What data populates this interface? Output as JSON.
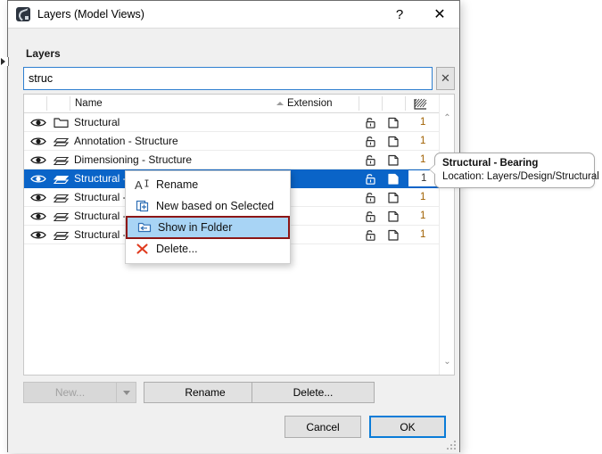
{
  "window": {
    "title": "Layers (Model Views)",
    "app_icon": "archicad-logo-icon",
    "help_label": "?",
    "close_label": "✕"
  },
  "section": {
    "label": "Layers"
  },
  "search": {
    "value": "struc",
    "placeholder": "",
    "clear_label": "✕"
  },
  "list": {
    "columns": [
      {
        "key": "visibility",
        "label": ""
      },
      {
        "key": "type",
        "label": ""
      },
      {
        "key": "name",
        "label": "Name",
        "sorted": "asc"
      },
      {
        "key": "extension",
        "label": "Extension"
      },
      {
        "key": "lock",
        "label": ""
      },
      {
        "key": "copy",
        "label": ""
      },
      {
        "key": "intersection",
        "label": "intersection-priority-icon"
      }
    ],
    "rows": [
      {
        "name": "Structural",
        "type": "folder",
        "extension": "",
        "lock": "unlocked",
        "copy": "copy",
        "number": "1",
        "selected": false
      },
      {
        "name": "Annotation - Structure",
        "type": "layer",
        "extension": "",
        "lock": "unlocked",
        "copy": "copy",
        "number": "1",
        "selected": false
      },
      {
        "name": "Dimensioning - Structure",
        "type": "layer",
        "extension": "",
        "lock": "unlocked",
        "copy": "copy",
        "number": "1",
        "selected": false
      },
      {
        "name": "Structural - ",
        "type": "layer",
        "extension": "",
        "lock": "unlocked",
        "copy": "copy",
        "number": "1",
        "selected": true
      },
      {
        "name": "Structural - ",
        "type": "layer",
        "extension": "",
        "lock": "unlocked",
        "copy": "copy",
        "number": "1",
        "selected": false
      },
      {
        "name": "Structural - ",
        "type": "layer",
        "extension": "",
        "lock": "unlocked",
        "copy": "copy",
        "number": "1",
        "selected": false
      },
      {
        "name": "Structural - ",
        "type": "layer",
        "extension": "",
        "lock": "unlocked",
        "copy": "copy",
        "number": "1",
        "selected": false
      }
    ],
    "scroll_up": "⌃",
    "scroll_down": "⌄"
  },
  "context_menu": {
    "items": [
      {
        "label": "Rename",
        "icon": "rename-text-icon",
        "highlighted": false
      },
      {
        "label": "New based on Selected",
        "icon": "new-from-selected-icon",
        "highlighted": false
      },
      {
        "label": "Show in Folder",
        "icon": "show-in-folder-icon",
        "highlighted": true
      },
      {
        "label": "Delete...",
        "icon": "delete-x-icon",
        "highlighted": false
      }
    ]
  },
  "tooltip": {
    "title": "Structural - Bearing",
    "location": "Location: Layers/Design/Structural"
  },
  "buttons": {
    "new": "New...",
    "new_enabled": false,
    "rename": "Rename",
    "delete": "Delete...",
    "cancel": "Cancel",
    "ok": "OK"
  },
  "colors": {
    "selection_blue": "#0a64c8",
    "focus_blue": "#0a7cd8",
    "menu_highlight": "#a8d4f5",
    "highlight_border": "#8c1616",
    "number_text": "#a06000",
    "dialog_bg": "#f0f0f0"
  }
}
